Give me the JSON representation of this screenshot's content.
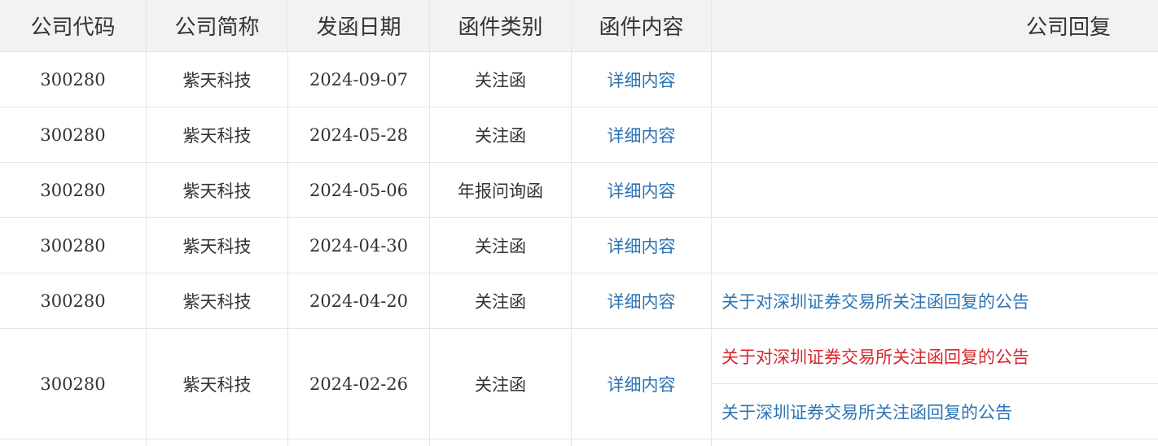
{
  "headers": [
    "公司代码",
    "公司简称",
    "发函日期",
    "函件类别",
    "函件内容",
    "公司回复"
  ],
  "rows": [
    {
      "code": "300280",
      "name": "紫天科技",
      "date": "2024-09-07",
      "category": "关注函",
      "content": "详细内容",
      "replies": []
    },
    {
      "code": "300280",
      "name": "紫天科技",
      "date": "2024-05-28",
      "category": "关注函",
      "content": "详细内容",
      "replies": []
    },
    {
      "code": "300280",
      "name": "紫天科技",
      "date": "2024-05-06",
      "category": "年报问询函",
      "content": "详细内容",
      "replies": []
    },
    {
      "code": "300280",
      "name": "紫天科技",
      "date": "2024-04-30",
      "category": "关注函",
      "content": "详细内容",
      "replies": []
    },
    {
      "code": "300280",
      "name": "紫天科技",
      "date": "2024-04-20",
      "category": "关注函",
      "content": "详细内容",
      "replies": [
        "关于对深圳证券交易所关注函回复的公告"
      ]
    },
    {
      "code": "300280",
      "name": "紫天科技",
      "date": "2024-02-26",
      "category": "关注函",
      "content": "详细内容",
      "replies": [
        "关于对深圳证券交易所关注函回复的公告",
        "关于深圳证券交易所关注函回复的公告"
      ]
    }
  ],
  "colors": {
    "link": "#2d74b5",
    "link_visited_red": "#d7262d",
    "header_bg": "#f2f2f2",
    "border": "#e6e6e6",
    "text": "#333333"
  }
}
